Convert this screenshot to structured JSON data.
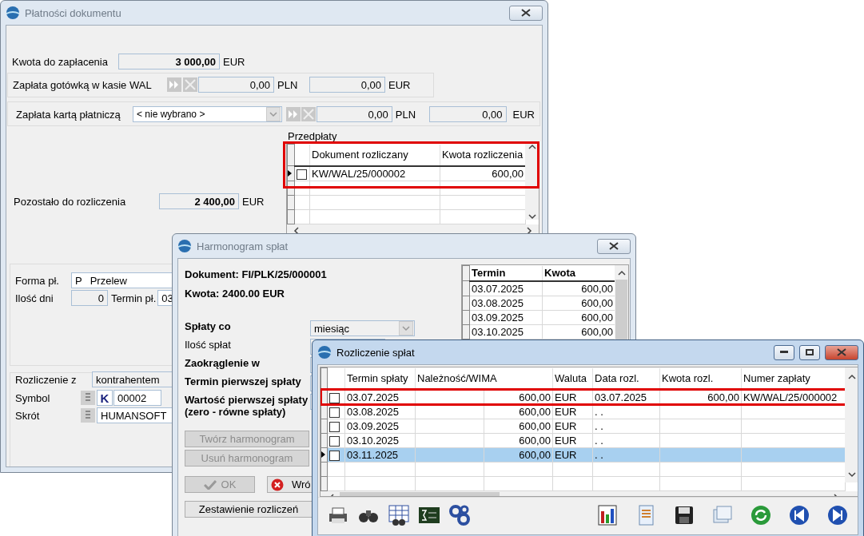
{
  "payment_window": {
    "title": "Płatności dokumentu",
    "active": false,
    "amount_due": {
      "label": "Kwota do zapłacenia",
      "value": "3 000,00",
      "currency": "EUR"
    },
    "cash_payment": {
      "label": "Zapłata gotówką w kasie WAL",
      "amount_pln": "0,00",
      "currency_pln": "PLN",
      "amount_eur": "0,00",
      "currency_eur": "EUR"
    },
    "card_payment": {
      "label": "Zapłata kartą płatniczą",
      "card": "< nie wybrano >",
      "amount_pln": "0,00",
      "currency_pln": "PLN",
      "amount_eur": "0,00",
      "currency_eur": "EUR"
    },
    "prepayments": {
      "label": "Przedpłaty",
      "annotated": true,
      "columns": [
        "Dokument rozliczany",
        "Kwota rozliczenia"
      ],
      "rows": [
        {
          "document": "KW/WAL/25/000002",
          "amount": "600,00",
          "checked": false,
          "selected": true
        }
      ]
    },
    "remaining": {
      "label": "Pozostało do rozliczenia",
      "value": "2 400,00",
      "currency": "EUR"
    },
    "payment_form": {
      "label": "Forma pł.",
      "code": "P",
      "name": "Przelew"
    },
    "days": {
      "label": "Ilość dni",
      "value": "0"
    },
    "due_date": {
      "label": "Termin pł.",
      "value": "03"
    },
    "settlement_with": {
      "label": "Rozliczenie z",
      "value": "kontrahentem"
    },
    "symbol": {
      "label": "Symbol",
      "type": "K",
      "value": "00002"
    },
    "short_name": {
      "label": "Skrót",
      "value": "HUMANSOFT"
    }
  },
  "schedule_window": {
    "title": "Harmonogram spłat",
    "active": false,
    "document": "Dokument: FI/PLK/25/000001",
    "amount": "Kwota: 2400.00 EUR",
    "fields": [
      {
        "kind": "combo",
        "label": "Spłaty co",
        "bold": true,
        "value": "miesiąc"
      },
      {
        "kind": "field",
        "label": "Ilość spłat",
        "bold": false
      },
      {
        "kind": "field",
        "label": "Zaokrąglenie w",
        "bold": true
      },
      {
        "kind": "field",
        "label": "Termin pierwszej spłaty",
        "bold": true
      },
      {
        "kind": "field",
        "label": "Wartość pierwszej spłaty",
        "note": "(zero - równe spłaty)",
        "bold": true
      }
    ],
    "buttons": [
      {
        "label": "Twórz harmonogram",
        "disabled": true
      },
      {
        "label": "Usuń harmonogram",
        "disabled": true
      }
    ],
    "ok_button": {
      "label": "OK",
      "disabled": true
    },
    "back_button": {
      "label": "Wró",
      "disabled": false
    },
    "summary_button": {
      "label": "Zestawienie rozliczeń",
      "disabled": false
    },
    "schedule": {
      "columns": [
        "Termin",
        "Kwota"
      ],
      "rows": [
        {
          "date": "03.07.2025",
          "amount": "600,00"
        },
        {
          "date": "03.08.2025",
          "amount": "600,00"
        },
        {
          "date": "03.09.2025",
          "amount": "600,00"
        },
        {
          "date": "03.10.2025",
          "amount": "600,00"
        }
      ]
    }
  },
  "settlement_window": {
    "title": "Rozliczenie spłat",
    "active": true,
    "columns": [
      "Termin spłaty",
      "Należność/WIMA",
      "Waluta",
      "Data rozl.",
      "Kwota rozl.",
      "Numer zapłaty"
    ],
    "rows": [
      {
        "due_date": "03.07.2025",
        "amount": "600,00",
        "currency": "EUR",
        "settled_date": "03.07.2025",
        "settled_amount": "600,00",
        "payment_number": "KW/WAL/25/000002",
        "checked": false,
        "selected": false,
        "annotated": true
      },
      {
        "due_date": "03.08.2025",
        "amount": "600,00",
        "currency": "EUR",
        "settled_date": ". .",
        "checked": false,
        "selected": false,
        "annotated": false
      },
      {
        "due_date": "03.09.2025",
        "amount": "600,00",
        "currency": "EUR",
        "settled_date": ". .",
        "checked": false,
        "selected": false,
        "annotated": false
      },
      {
        "due_date": "03.10.2025",
        "amount": "600,00",
        "currency": "EUR",
        "settled_date": ". .",
        "checked": false,
        "selected": false,
        "annotated": false
      },
      {
        "due_date": "03.11.2025",
        "amount": "600,00",
        "currency": "EUR",
        "settled_date": ". .",
        "checked": false,
        "selected": true,
        "annotated": false
      }
    ]
  }
}
